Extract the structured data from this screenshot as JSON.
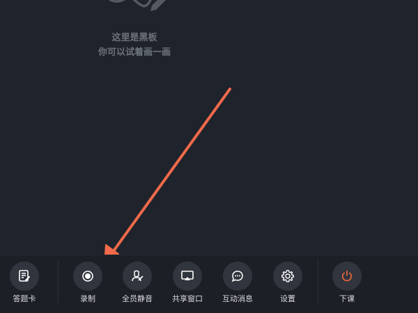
{
  "board": {
    "hint_line1": "这里是黑板",
    "hint_line2": "你可以试着画一画"
  },
  "toolbar": {
    "items": [
      {
        "label": "答题卡",
        "icon": "answer-sheet-icon"
      },
      {
        "label": "录制",
        "icon": "record-icon"
      },
      {
        "label": "全员静音",
        "icon": "mute-all-icon"
      },
      {
        "label": "共享窗口",
        "icon": "share-window-icon"
      },
      {
        "label": "互动消息",
        "icon": "chat-bubble-icon"
      },
      {
        "label": "设置",
        "icon": "gear-icon"
      },
      {
        "label": "下课",
        "icon": "power-icon"
      }
    ]
  },
  "colors": {
    "background": "#1f232b",
    "button": "#31353d",
    "label": "#d9dbde",
    "hint": "#6e737b",
    "power": "#e4633a",
    "arrow": "#f26a4b"
  }
}
